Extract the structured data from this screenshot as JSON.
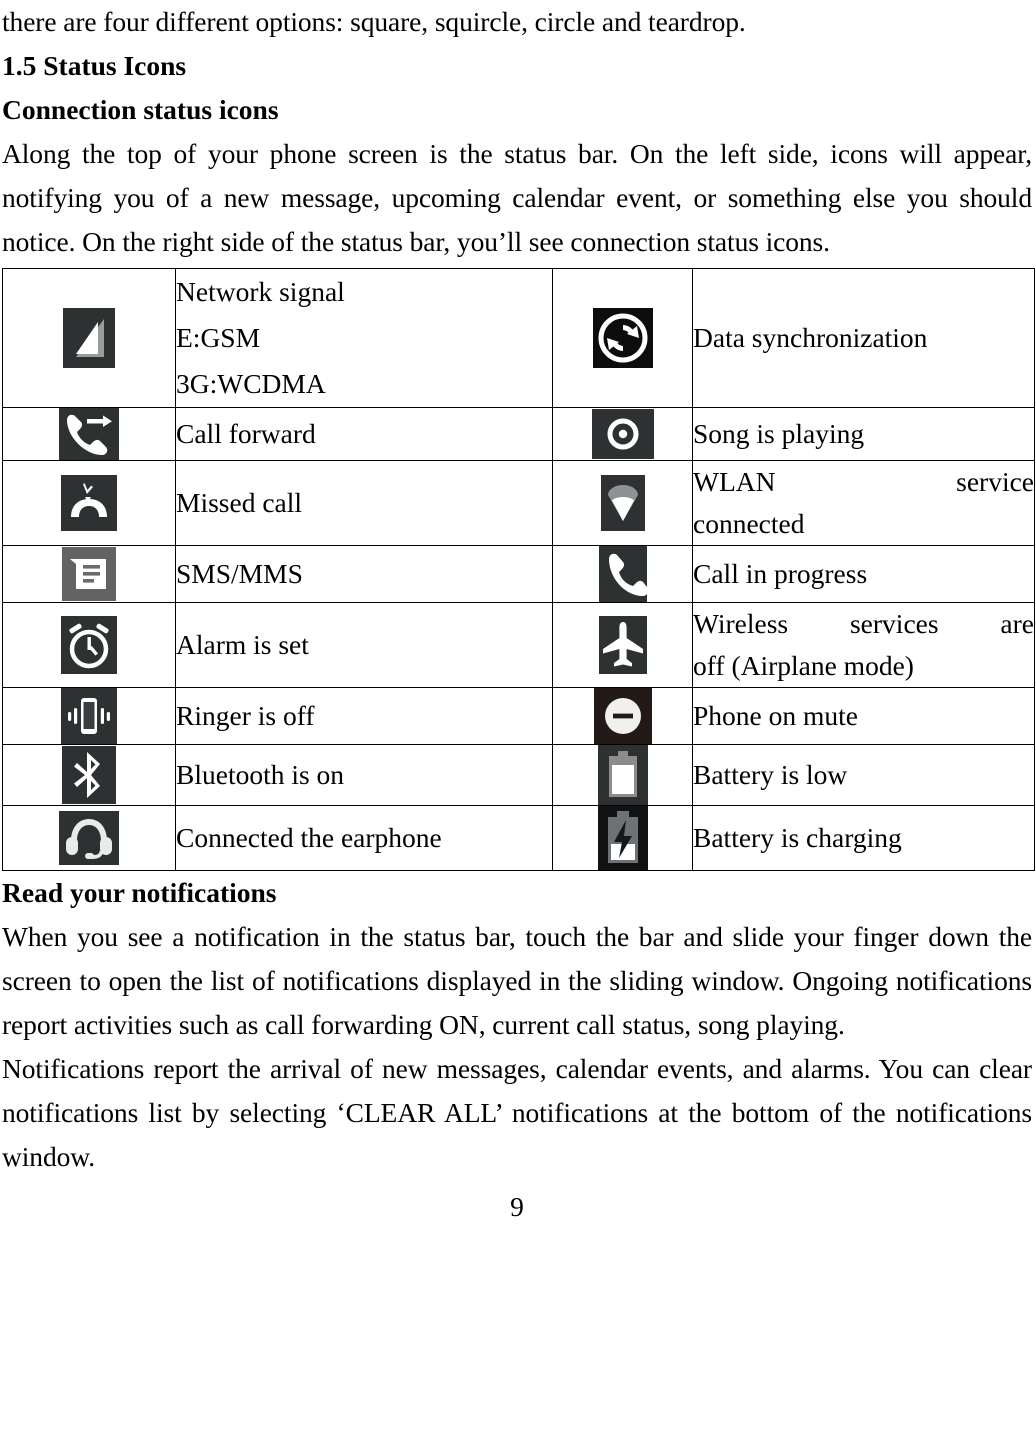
{
  "document": {
    "page_number": "9",
    "intro_line": "there are four different options: square, squircle, circle and teardrop.",
    "section_heading": "1.5 Status Icons",
    "subheading_1": "Connection status icons",
    "paragraph_1": "Along the top of your phone screen is the status bar. On the left side, icons will appear, notifying you of a new message, upcoming calendar event, or something else you should notice. On the right side of the status bar, you’ll see connection status icons.",
    "subheading_2": "Read your notifications",
    "paragraph_2": "When you see a notification in the status bar, touch the bar and slide your finger down the screen to open the list of notifications displayed in the sliding window. Ongoing notifications report activities such as call forwarding ON, current call status, song playing.",
    "paragraph_3": "Notifications report the arrival of new messages, calendar events, and alarms. You can clear notifications list by selecting ‘CLEAR ALL’ notifications at the bottom of the notifications window."
  },
  "status_icon_table": {
    "rows": [
      {
        "left_icon": "network-signal-icon",
        "left_label_line1": "Network signal",
        "left_label_line2": "E:GSM",
        "left_label_line3": "3G:WCDMA",
        "right_icon": "data-sync-icon",
        "right_label": "Data synchronization"
      },
      {
        "left_icon": "call-forward-icon",
        "left_label": "Call forward",
        "right_icon": "song-playing-icon",
        "right_label": "Song is playing"
      },
      {
        "left_icon": "missed-call-icon",
        "left_label": "Missed call",
        "right_icon": "wlan-connected-icon",
        "right_label_part1": "WLAN service",
        "right_label_part2": "connected"
      },
      {
        "left_icon": "sms-mms-icon",
        "left_label": "SMS/MMS",
        "right_icon": "call-in-progress-icon",
        "right_label": "Call in progress"
      },
      {
        "left_icon": "alarm-set-icon",
        "left_label": "Alarm is set",
        "right_icon": "airplane-mode-icon",
        "right_label_part1": "Wireless services are",
        "right_label_part2": "off (Airplane mode)"
      },
      {
        "left_icon": "ringer-off-icon",
        "left_label": "Ringer is off",
        "right_icon": "phone-mute-icon",
        "right_label": "Phone on mute"
      },
      {
        "left_icon": "bluetooth-on-icon",
        "left_label": "Bluetooth is on",
        "right_icon": "battery-low-icon",
        "right_label": "Battery is low"
      },
      {
        "left_icon": "earphone-connected-icon",
        "left_label": "Connected the earphone",
        "right_icon": "battery-charging-icon",
        "right_label": "Battery is charging"
      }
    ]
  },
  "colors": {
    "text": "#000000",
    "page_background": "#ffffff",
    "icon_dark_badge": "#2e3132",
    "icon_black_badge": "#0d0d0d",
    "icon_gray_badge": "#636363",
    "icon_brown_badge": "#231a17",
    "icon_glyph": "#ffffff"
  }
}
